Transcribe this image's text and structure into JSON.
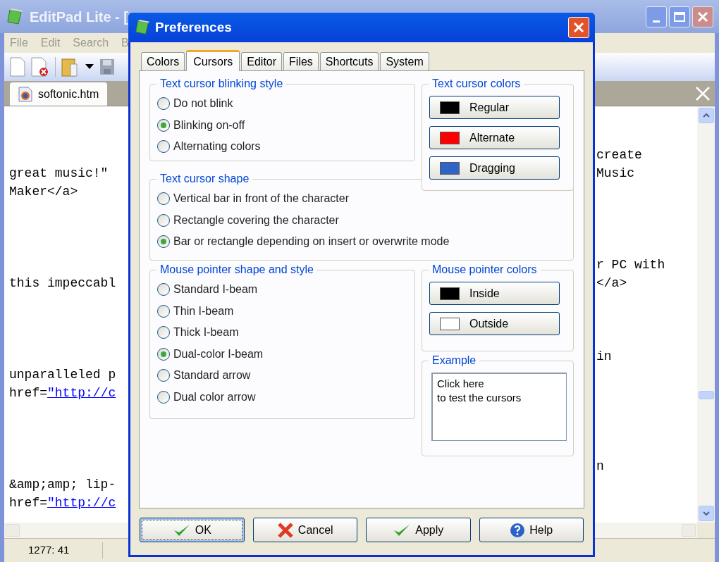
{
  "app": {
    "title": "EditPad Lite - [",
    "menu": [
      "File",
      "Edit",
      "Search",
      "B"
    ],
    "file_tab": {
      "label": "softonic.htm"
    },
    "editor": {
      "paragraphs": [
        [
          {
            "right": "create"
          },
          {
            "left": "great music!\"",
            "right": "Music"
          },
          {
            "left": "Maker</a>"
          }
        ],
        [
          {
            "right": "r PC with"
          },
          {
            "left": "this impeccabl",
            "right": "</a>"
          }
        ],
        [
          {
            "right": "in"
          },
          {
            "left": "unparalleled p"
          },
          {
            "left": "href=",
            "left_link": "\"http://c"
          }
        ],
        [
          {
            "right": "n"
          },
          {
            "left": "&amp;amp; lip-"
          },
          {
            "left": "href=",
            "left_link": "\"http://c"
          }
        ]
      ]
    },
    "status_bar": {
      "position": "1277: 41"
    }
  },
  "dialog": {
    "title": "Preferences",
    "tabs": [
      {
        "label": "Colors",
        "selected": false
      },
      {
        "label": "Cursors",
        "selected": true
      },
      {
        "label": "Editor",
        "selected": false
      },
      {
        "label": "Files",
        "selected": false
      },
      {
        "label": "Shortcuts",
        "selected": false
      },
      {
        "label": "System",
        "selected": false
      }
    ],
    "blinking_style": {
      "legend": "Text cursor blinking style",
      "options": [
        {
          "label": "Do not blink",
          "selected": false
        },
        {
          "label": "Blinking on-off",
          "selected": true
        },
        {
          "label": "Alternating colors",
          "selected": false
        }
      ]
    },
    "cursor_colors": {
      "legend": "Text cursor colors",
      "buttons": [
        {
          "label": "Regular",
          "color": "#000000"
        },
        {
          "label": "Alternate",
          "color": "#ff0000"
        },
        {
          "label": "Dragging",
          "color": "#3165c5"
        }
      ]
    },
    "cursor_shape": {
      "legend": "Text cursor shape",
      "options": [
        {
          "label": "Vertical bar in front of the character",
          "selected": false
        },
        {
          "label": "Rectangle covering the character",
          "selected": false
        },
        {
          "label": "Bar or rectangle depending on insert or overwrite mode",
          "selected": true
        }
      ]
    },
    "pointer_shape": {
      "legend": "Mouse pointer shape and style",
      "options": [
        {
          "label": "Standard I-beam",
          "selected": false
        },
        {
          "label": "Thin I-beam",
          "selected": false
        },
        {
          "label": "Thick I-beam",
          "selected": false
        },
        {
          "label": "Dual-color I-beam",
          "selected": true
        },
        {
          "label": "Standard arrow",
          "selected": false
        },
        {
          "label": "Dual color arrow",
          "selected": false
        }
      ]
    },
    "pointer_colors": {
      "legend": "Mouse pointer colors",
      "buttons": [
        {
          "label": "Inside",
          "color": "#000000"
        },
        {
          "label": "Outside",
          "color": "#ffffff"
        }
      ]
    },
    "example": {
      "legend": "Example",
      "lines": [
        "Click here",
        "to test the cursors"
      ]
    },
    "buttons": [
      {
        "label": "OK",
        "kind": "ok",
        "focused": true
      },
      {
        "label": "Cancel",
        "kind": "cancel",
        "focused": false
      },
      {
        "label": "Apply",
        "kind": "apply",
        "focused": false
      },
      {
        "label": "Help",
        "kind": "help",
        "focused": false
      }
    ]
  }
}
